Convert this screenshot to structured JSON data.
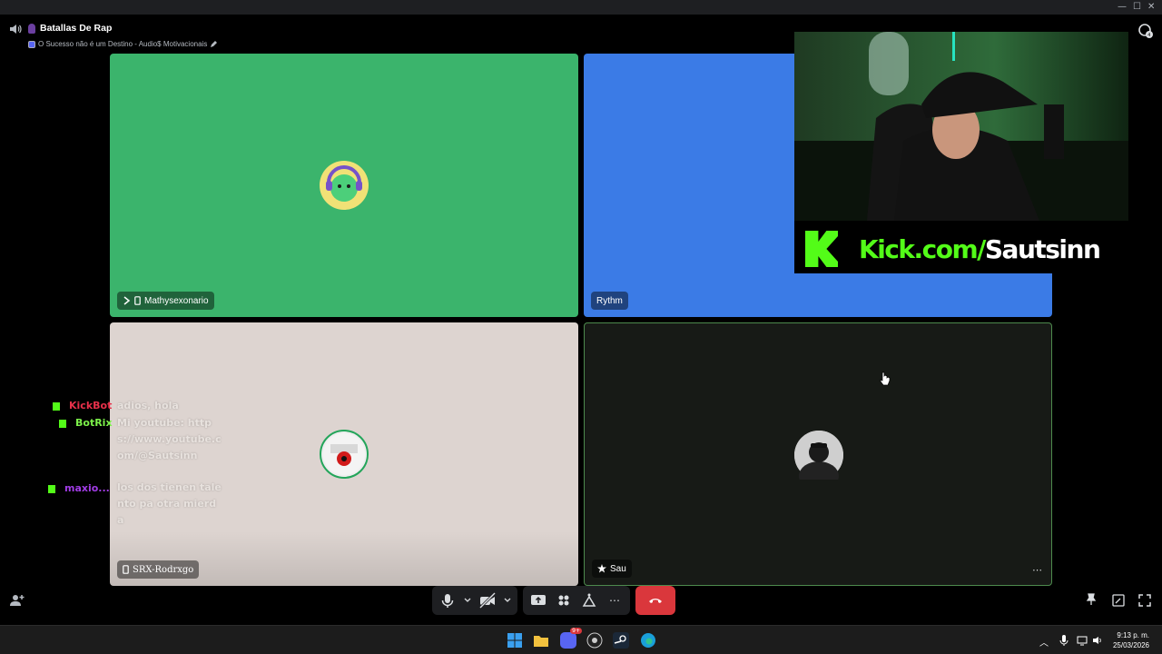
{
  "window": {
    "controls": [
      "—",
      "☐",
      "✕"
    ]
  },
  "header": {
    "channel_title": "Batallas De Rap",
    "activity_text": "O Sucesso não é um Destino - Audio$ Motivacionais"
  },
  "tiles": [
    {
      "name": "Mathysexonario",
      "bg": "#3bb46c"
    },
    {
      "name": "Rythm",
      "bg": "#3b7be6"
    },
    {
      "name": "SRX-Rodrxgo",
      "bg": "#ddd4d0"
    },
    {
      "name": "Sau",
      "bg": "#171a16"
    }
  ],
  "overlay": {
    "kick_prefix": "Kick.com/",
    "kick_channel": "Sautsinn"
  },
  "chat": [
    {
      "user": "KickBot",
      "message": "adios, hola",
      "color": "#e8304a"
    },
    {
      "user": "BotRix",
      "message": "Mi youtube: https://www.youtube.com/@Sautsinn",
      "color": "#7cf04a"
    },
    {
      "user": "maxio...",
      "message": "los dos tienen talento pa otra mierda",
      "color": "#a13ce6"
    }
  ],
  "taskbar": {
    "time": "9:13 p. m.",
    "date": "25/03/2026",
    "discord_badge": "9+"
  },
  "colors": {
    "accent_red": "#da373c",
    "kick_green": "#53fc18",
    "speaking_ring": "#23a55a"
  }
}
